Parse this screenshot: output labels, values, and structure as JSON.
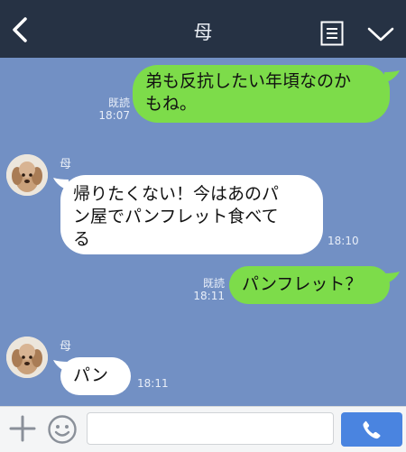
{
  "header": {
    "title": "母",
    "back_icon": "chevron-left-icon",
    "note_icon": "notes-icon",
    "menu_icon": "chevron-down-icon"
  },
  "messages": [
    {
      "from": "me",
      "text_lines": [
        "弟も反抗したい年頃なのか",
        "もね。"
      ],
      "read": "既読",
      "time": "18:07"
    },
    {
      "from": "母",
      "sender": "母",
      "text_lines": [
        "帰りたくない！今はあのパ",
        "ン屋でパンフレット食べて",
        "る"
      ],
      "time": "18:10"
    },
    {
      "from": "me",
      "text_lines": [
        "パンフレット？"
      ],
      "read": "既読",
      "time": "18:11"
    },
    {
      "from": "母",
      "sender": "母",
      "text_lines": [
        "パン"
      ],
      "time": "18:11"
    }
  ],
  "input_bar": {
    "plus_icon": "plus-icon",
    "sticker_icon": "smiley-icon",
    "message_value": "",
    "call_icon": "phone-icon"
  },
  "colors": {
    "background": "#7290c4",
    "header": "#263244",
    "my_bubble": "#7ddc4a",
    "their_bubble": "#ffffff",
    "call_button": "#4a84e0"
  }
}
